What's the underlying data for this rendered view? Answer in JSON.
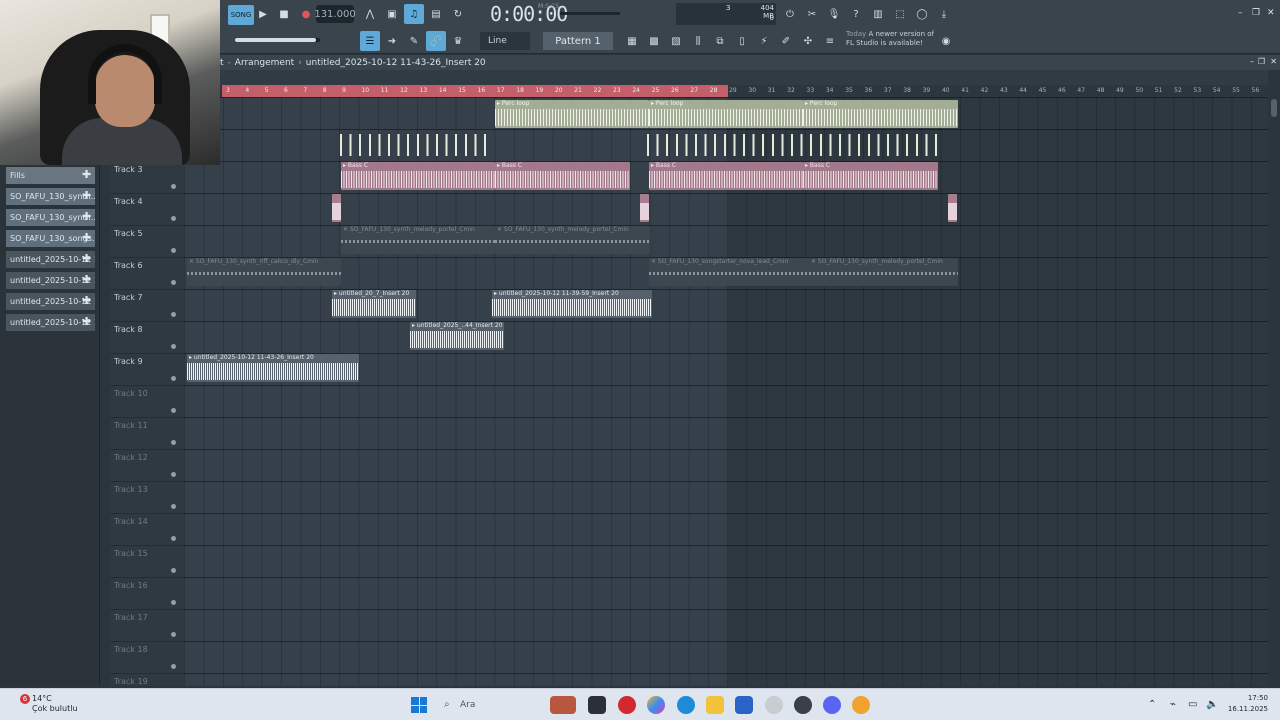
{
  "toolbar": {
    "song_mode": "SONG",
    "bpm": "131.000",
    "time": "0:00:00",
    "time_unit": "M:S:CS",
    "cpu": "3",
    "memory": "404 MB",
    "voices": "0",
    "snap_mode": "Line",
    "pattern": "Pattern 1",
    "news_date": "Today",
    "news_text": "A newer version of",
    "news_text2": "FL Studio is available!"
  },
  "playlist": {
    "title": "Arrangement",
    "prefix": "t",
    "song": "untitled_2025-10-12 11-43-26_Insert 20",
    "ruler_ticks": [
      "3",
      "4",
      "5",
      "6",
      "7",
      "8",
      "9",
      "10",
      "11",
      "12",
      "13",
      "14",
      "15",
      "16",
      "17",
      "18",
      "19",
      "20",
      "21",
      "22",
      "23",
      "24",
      "25",
      "26",
      "27",
      "28",
      "29",
      "30",
      "31",
      "32",
      "33",
      "34",
      "35",
      "36",
      "37",
      "38",
      "39",
      "40",
      "41",
      "42",
      "43",
      "44",
      "45",
      "46",
      "47",
      "48",
      "49",
      "50",
      "51",
      "52",
      "53",
      "54",
      "55",
      "56"
    ],
    "tracks": [
      "Track 3",
      "Track 4",
      "Track 5",
      "Track 6",
      "Track 7",
      "Track 8",
      "Track 9",
      "Track 10",
      "Track 11",
      "Track 12",
      "Track 13",
      "Track 14",
      "Track 15",
      "Track 16",
      "Track 17",
      "Track 18",
      "Track 19"
    ]
  },
  "browser": {
    "items": [
      "Fills",
      "SO_FAFU_130_synth...",
      "SO_FAFU_130_synth...",
      "SO_FAFU_130_songs...",
      "untitled_2025-10-12 11-...",
      "untitled_2025-10-12 11-...",
      "untitled_2025-10-12 11-...",
      "untitled_2025-10-12 11-..."
    ]
  },
  "clips": {
    "perc": "Perc loop",
    "bass": "Bass C",
    "melody": "SO_FAFU_130_synth_melody_portel_Cmin",
    "riff": "SO_FAFU_130_synth_riff_calico_dly_Cmin",
    "songstarter": "SO_FAFU_130_songstarter_nova_lead_Cmin",
    "audio1": "untitled_20_7_Insert 20",
    "audio2": "untitled_2025-10-12 11-39-59_Insert 20",
    "audio3": "untitled_2025_..44_Insert 20",
    "audio4": "untitled_2025-10-12 11-43-26_Insert 20"
  },
  "taskbar": {
    "temp": "14°C",
    "weather": "Çok bulutlu",
    "search": "Ara",
    "time": "17:50",
    "date": "16.11.2025",
    "notification_count": "6"
  }
}
